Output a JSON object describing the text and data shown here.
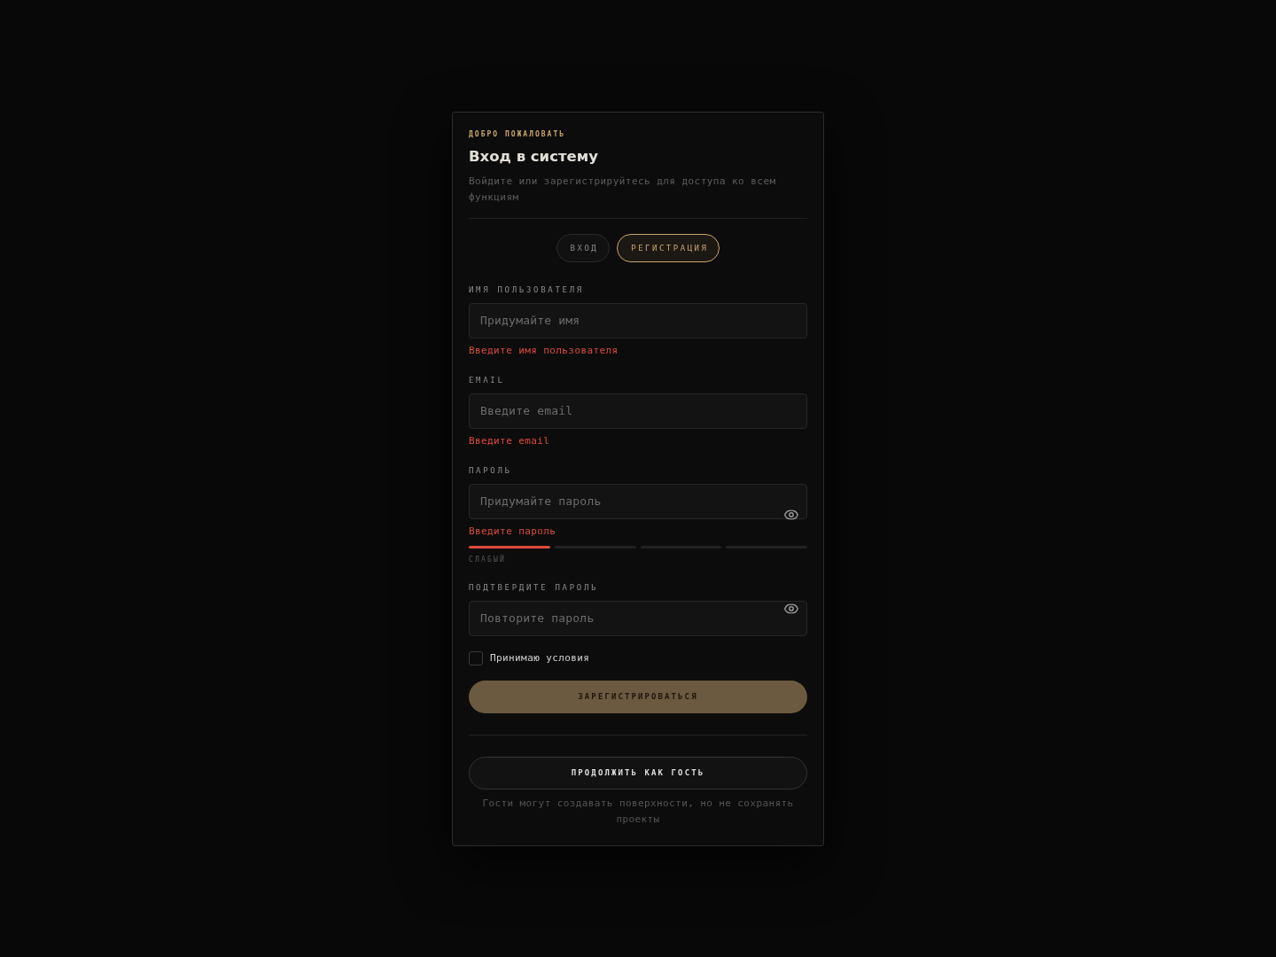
{
  "card": {
    "eyebrow": "ДОБРО ПОЖАЛОВАТЬ",
    "title": "Вход в систему",
    "subtitle": "Войдите или зарегистрируйтесь для доступа ко всем функциям"
  },
  "tabs": [
    {
      "label": "ВХОД",
      "selected": false
    },
    {
      "label": "РЕГИСТРАЦИЯ",
      "selected": true
    }
  ],
  "fields": [
    {
      "kind": "text",
      "label": "ИМЯ ПОЛЬЗОВАТЕЛЯ",
      "placeholder": "Придумайте имя",
      "error": "Введите имя пользователя"
    },
    {
      "kind": "text",
      "label": "EMAIL",
      "placeholder": "Введите email",
      "error": "Введите email"
    },
    {
      "kind": "password",
      "label": "ПАРОЛЬ",
      "placeholder": "Придумайте пароль",
      "error": "Введите пароль",
      "strength": {
        "level": 0.25,
        "label": "СЛАБЫЙ"
      }
    },
    {
      "kind": "password",
      "label": "ПОДТВЕРДИТЕ ПАРОЛЬ",
      "placeholder": "Повторите пароль"
    }
  ],
  "terms": {
    "label": "Принимаю условия",
    "checked": false
  },
  "submit": "ЗАРЕГИСТРИРОВАТЬСЯ",
  "guest": {
    "button": "ПРОДОЛЖИТЬ КАК ГОСТЬ",
    "note": "Гости могут создавать поверхности, но не сохранять проекты"
  }
}
